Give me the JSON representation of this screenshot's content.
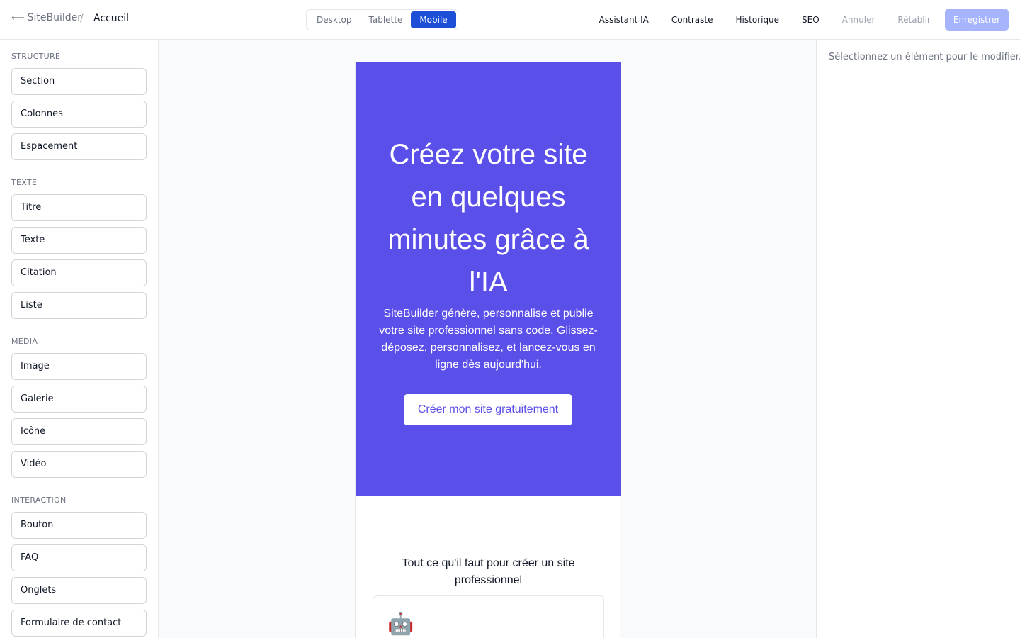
{
  "topbar": {
    "back_label": "SiteBuilder",
    "separator": "/",
    "page_name": "Accueil",
    "devices": [
      "Desktop",
      "Tablette",
      "Mobile"
    ],
    "active_device": "Mobile",
    "actions": {
      "ai_assistant": "Assistant IA",
      "contrast": "Contraste",
      "history": "Historique",
      "seo": "SEO",
      "undo": "Annuler",
      "redo": "Rétablir",
      "save": "Enregistrer"
    }
  },
  "sidebar": {
    "groups": [
      {
        "title": "STRUCTURE",
        "items": [
          "Section",
          "Colonnes",
          "Espacement"
        ]
      },
      {
        "title": "TEXTE",
        "items": [
          "Titre",
          "Texte",
          "Citation",
          "Liste"
        ]
      },
      {
        "title": "MÉDIA",
        "items": [
          "Image",
          "Galerie",
          "Icône",
          "Vidéo"
        ]
      },
      {
        "title": "INTERACTION",
        "items": [
          "Bouton",
          "FAQ",
          "Onglets",
          "Formulaire de contact"
        ]
      }
    ]
  },
  "canvas": {
    "hero": {
      "title": "Créez votre site en quelques minutes grâce à l'IA",
      "subtitle": "SiteBuilder génère, personnalise et publie votre site professionnel sans code. Glissez-déposez, personnalisez, et lancez-vous en ligne dès aujourd'hui.",
      "cta": "Créer mon site gratuitement",
      "bg_color": "#5b4fe9"
    },
    "features": {
      "title": "Tout ce qu'il faut pour créer un site professionnel",
      "first_icon": "robot-icon",
      "first_icon_glyph": "🤖"
    }
  },
  "properties_panel": {
    "empty_message": "Sélectionnez un élément pour le modifier."
  },
  "colors": {
    "accent": "#1d4ed8",
    "save_button": "#a5b4fc"
  }
}
